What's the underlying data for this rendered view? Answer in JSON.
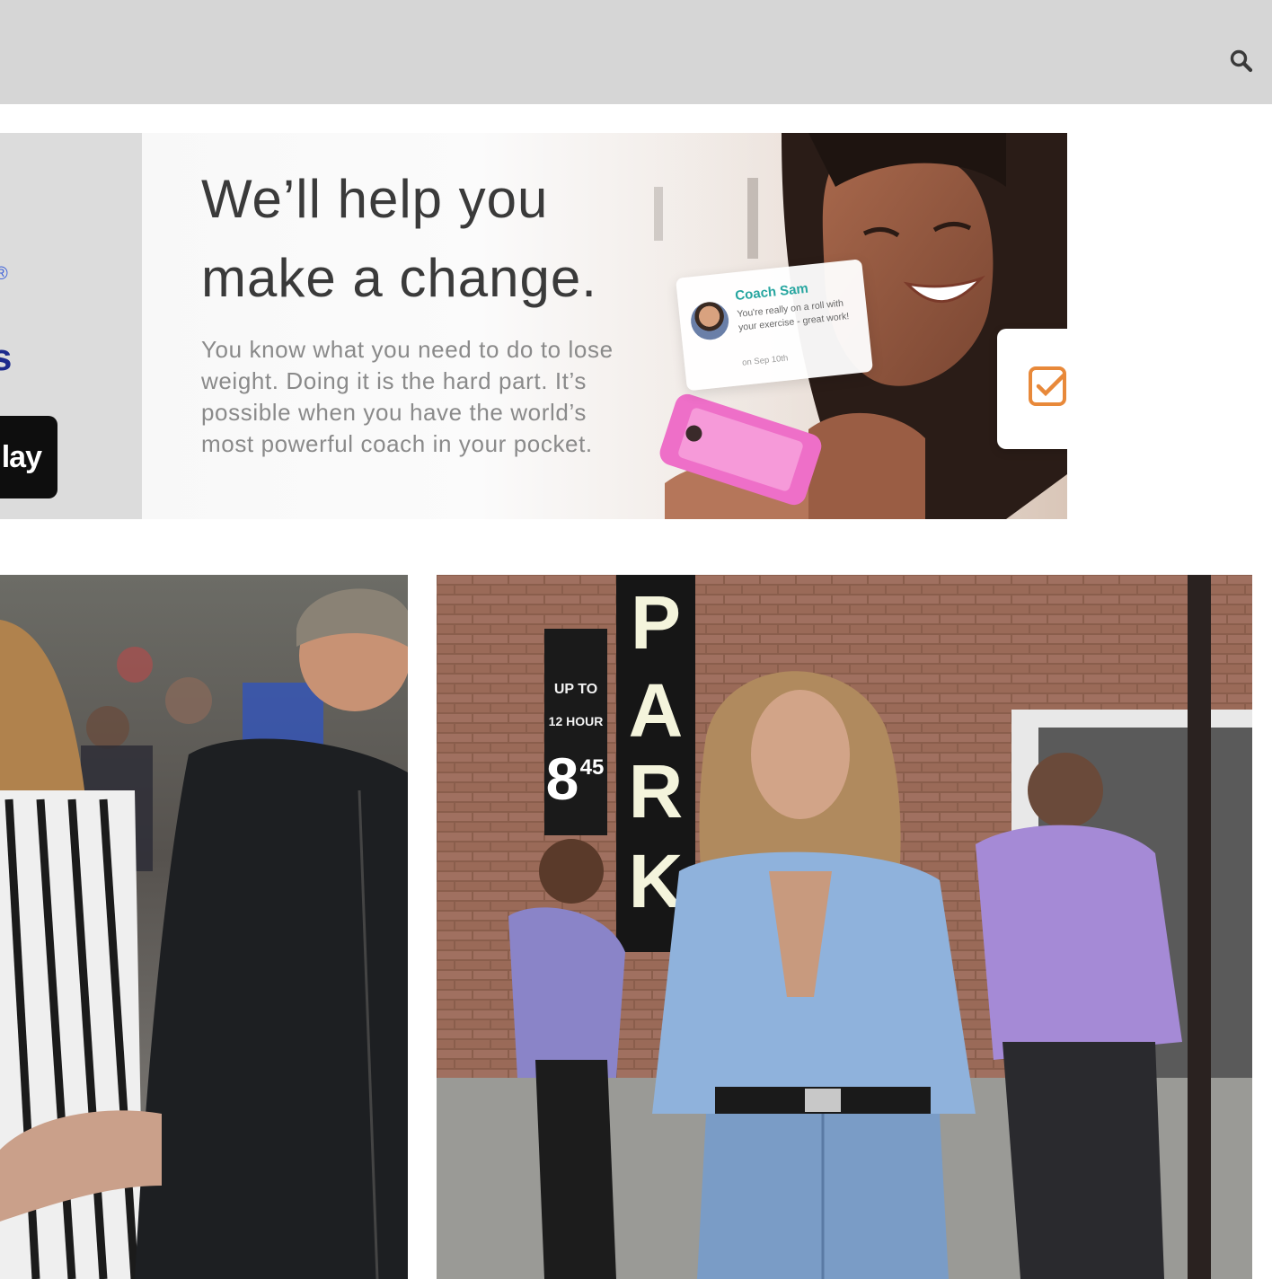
{
  "header": {
    "search_icon": "search-icon",
    "background": "#d6d6d6"
  },
  "banner": {
    "registered_mark": "®",
    "partial_letter": "s",
    "store_badge_text": "lay",
    "headline_line1": "We’ll help you",
    "headline_line2": "make a change.",
    "body": "You know what you need to do to lose weight. Doing it is the hard part. It’s possible when you have the world’s most powerful coach in your pocket.",
    "coach_card": {
      "name": "Coach Sam",
      "message": "You're really on a roll with your exercise - great work!",
      "date": "on Sep 10th"
    },
    "checkbox_icon": "checkbox-icon",
    "accent_teal": "#27a6a0",
    "accent_orange": "#e8893a"
  },
  "photos": {
    "left": {
      "subject": "street-photo-couple"
    },
    "right": {
      "sign_letters": [
        "P",
        "A",
        "R",
        "K"
      ],
      "price_sign_line1": "UP TO",
      "price_sign_line2": "12 HOUR",
      "price_sign_price": "8",
      "price_sign_cents": "45"
    }
  }
}
